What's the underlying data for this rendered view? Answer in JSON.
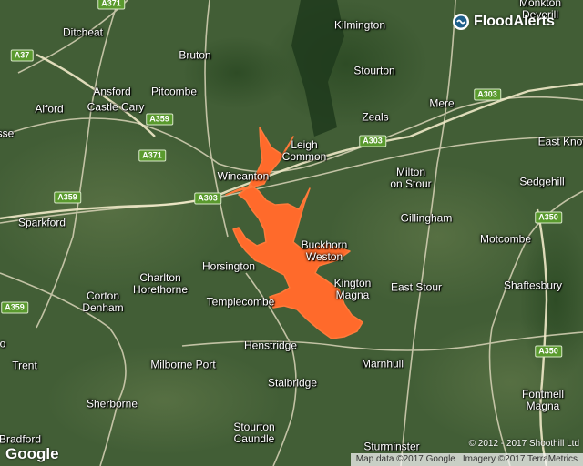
{
  "brand": {
    "name": "FloodAlerts",
    "logo_icon": "floodalerts-logo-icon"
  },
  "map": {
    "type": "satellite",
    "flood_color": "#ff6a2b",
    "places": [
      {
        "id": "monkton-deverill",
        "label": "Monkton\nDeverill"
      },
      {
        "id": "ditcheat",
        "label": "Ditcheat"
      },
      {
        "id": "kilmington",
        "label": "Kilmington"
      },
      {
        "id": "bruton",
        "label": "Bruton"
      },
      {
        "id": "stourton",
        "label": "Stourton"
      },
      {
        "id": "ansford",
        "label": "Ansford"
      },
      {
        "id": "pitcombe",
        "label": "Pitcombe"
      },
      {
        "id": "alford",
        "label": "Alford"
      },
      {
        "id": "castle-cary",
        "label": "Castle Cary"
      },
      {
        "id": "mere",
        "label": "Mere"
      },
      {
        "id": "zeals",
        "label": "Zeals"
      },
      {
        "id": "sse",
        "label": "sse"
      },
      {
        "id": "leigh-common",
        "label": "Leigh\nCommon"
      },
      {
        "id": "east-knoyle",
        "label": "East Knoy"
      },
      {
        "id": "wincanton",
        "label": "Wincanton"
      },
      {
        "id": "milton-on-stour",
        "label": "Milton\non Stour"
      },
      {
        "id": "sedgehill",
        "label": "Sedgehill"
      },
      {
        "id": "gillingham",
        "label": "Gillingham"
      },
      {
        "id": "sparkford",
        "label": "Sparkford"
      },
      {
        "id": "buckhorn-weston",
        "label": "Buckhorn\nWeston"
      },
      {
        "id": "motcombe",
        "label": "Motcombe"
      },
      {
        "id": "horsington",
        "label": "Horsington"
      },
      {
        "id": "charlton-horethorne",
        "label": "Charlton\nHorethorne"
      },
      {
        "id": "kington-magna",
        "label": "Kington\nMagna"
      },
      {
        "id": "east-stour",
        "label": "East Stour"
      },
      {
        "id": "shaftesbury",
        "label": "Shaftesbury"
      },
      {
        "id": "corton-denham",
        "label": "Corton\nDenham"
      },
      {
        "id": "templecombe",
        "label": "Templecombe"
      },
      {
        "id": "henstridge",
        "label": "Henstridge"
      },
      {
        "id": "o",
        "label": "o"
      },
      {
        "id": "marnhull",
        "label": "Marnhull"
      },
      {
        "id": "trent",
        "label": "Trent"
      },
      {
        "id": "milborne-port",
        "label": "Milborne Port"
      },
      {
        "id": "stalbridge",
        "label": "Stalbridge"
      },
      {
        "id": "sherborne",
        "label": "Sherborne"
      },
      {
        "id": "fontmell-magna",
        "label": "Fontmell\nMagna"
      },
      {
        "id": "stourton-caundle",
        "label": "Stourton\nCaundle"
      },
      {
        "id": "bradford",
        "label": "Bradford"
      },
      {
        "id": "sturminster",
        "label": "Sturminster"
      }
    ],
    "road_shields": [
      {
        "id": "a371-top",
        "label": "A371"
      },
      {
        "id": "a37",
        "label": "A37"
      },
      {
        "id": "a303-ne",
        "label": "A303"
      },
      {
        "id": "a359-mid",
        "label": "A359"
      },
      {
        "id": "a371-mid",
        "label": "A371"
      },
      {
        "id": "a303-mid",
        "label": "A303"
      },
      {
        "id": "a359-left",
        "label": "A359"
      },
      {
        "id": "a303-center",
        "label": "A303"
      },
      {
        "id": "a350-top",
        "label": "A350"
      },
      {
        "id": "a359-bottom",
        "label": "A359"
      },
      {
        "id": "a350-bottom",
        "label": "A350"
      }
    ]
  },
  "footer": {
    "google_logo": "Google",
    "copyright": "© 2012 - 2017 Shoothill Ltd",
    "map_data": "Map data ©2017 Google",
    "imagery": "Imagery ©2017 TerraMetrics"
  }
}
